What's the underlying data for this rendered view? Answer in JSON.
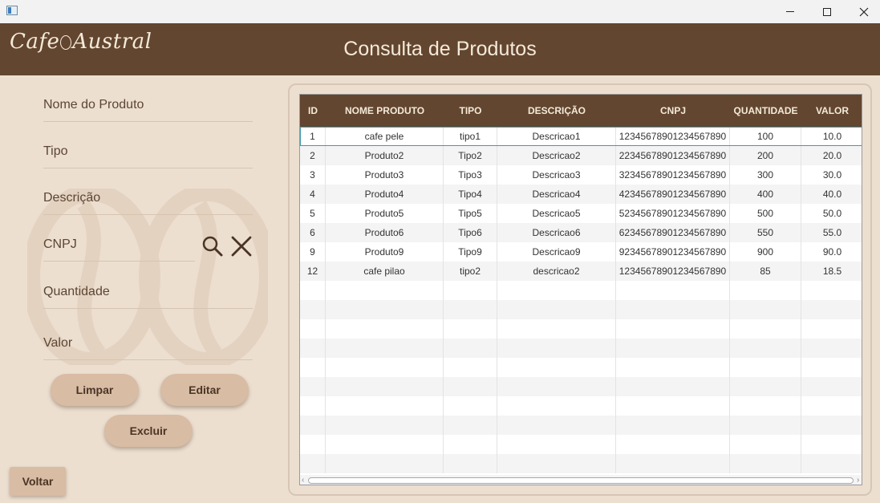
{
  "window": {
    "icons": {
      "app": "app-window-icon",
      "minimize": "minimize-icon",
      "maximize": "maximize-icon",
      "close": "close-icon"
    }
  },
  "header": {
    "logo_text_left": "Cafe",
    "logo_text_right": "Austral",
    "title": "Consulta de Produtos"
  },
  "form": {
    "fields": {
      "nome": {
        "placeholder": "Nome do Produto",
        "value": ""
      },
      "tipo": {
        "placeholder": "Tipo",
        "value": ""
      },
      "descricao": {
        "placeholder": "Descrição",
        "value": ""
      },
      "cnpj": {
        "placeholder": "CNPJ",
        "value": ""
      },
      "quantidade": {
        "placeholder": "Quantidade",
        "value": ""
      },
      "valor": {
        "placeholder": "Valor",
        "value": ""
      }
    },
    "buttons": {
      "limpar": "Limpar",
      "editar": "Editar",
      "excluir": "Excluir",
      "voltar": "Voltar"
    },
    "icons": {
      "search": "search-icon",
      "clear": "close-icon",
      "watermark": "coffee-beans-icon"
    }
  },
  "colors": {
    "header_bg": "#634630",
    "page_bg": "#ecdfd0",
    "button_bg": "#d8bca3",
    "selection": "#3a9bb4"
  },
  "table": {
    "columns": [
      "ID",
      "NOME PRODUTO",
      "TIPO",
      "DESCRIÇÃO",
      "CNPJ",
      "QUANTIDADE",
      "VALOR"
    ],
    "selected_row_index": 0,
    "rows": [
      [
        "1",
        "cafe pele",
        "tipo1",
        "Descricao1",
        "12345678901234567890",
        "100",
        "10.0"
      ],
      [
        "2",
        "Produto2",
        "Tipo2",
        "Descricao2",
        "22345678901234567890",
        "200",
        "20.0"
      ],
      [
        "3",
        "Produto3",
        "Tipo3",
        "Descricao3",
        "32345678901234567890",
        "300",
        "30.0"
      ],
      [
        "4",
        "Produto4",
        "Tipo4",
        "Descricao4",
        "42345678901234567890",
        "400",
        "40.0"
      ],
      [
        "5",
        "Produto5",
        "Tipo5",
        "Descricao5",
        "52345678901234567890",
        "500",
        "50.0"
      ],
      [
        "6",
        "Produto6",
        "Tipo6",
        "Descricao6",
        "62345678901234567890",
        "550",
        "55.0"
      ],
      [
        "9",
        "Produto9",
        "Tipo9",
        "Descricao9",
        "92345678901234567890",
        "900",
        "90.0"
      ],
      [
        "12",
        "cafe pilao",
        "tipo2",
        "descricao2",
        "12345678901234567890",
        "85",
        "18.5"
      ]
    ]
  }
}
